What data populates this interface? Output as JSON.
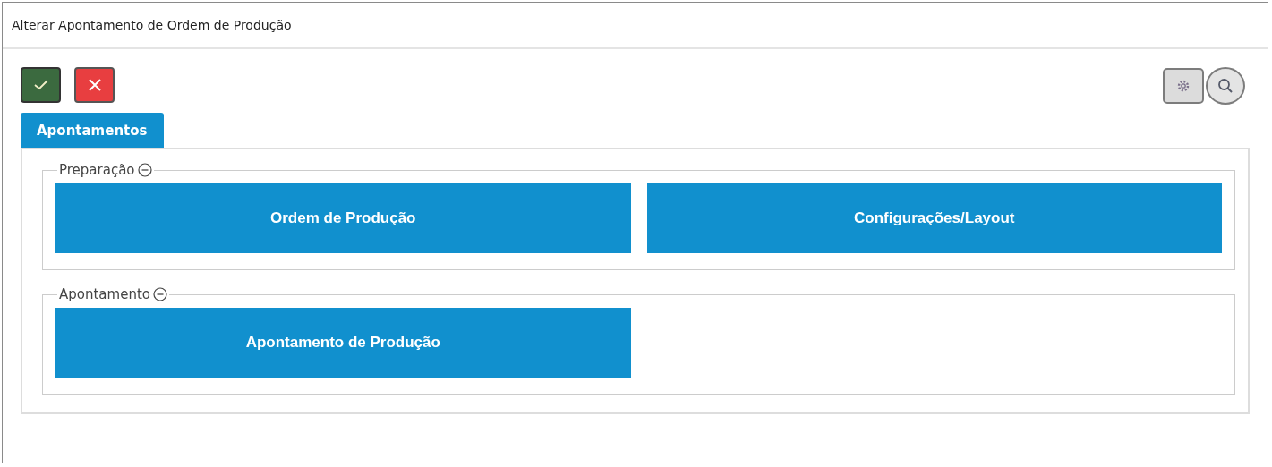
{
  "window": {
    "title": "Alterar Apontamento de Ordem de Produção"
  },
  "tabs": [
    {
      "label": "Apontamentos",
      "selected": true
    }
  ],
  "sections": [
    {
      "title": "Preparação",
      "expanded": true,
      "tiles": [
        "Ordem de Produção",
        "Configurações/Layout"
      ]
    },
    {
      "title": "Apontamento",
      "expanded": true,
      "tiles": [
        "Apontamento de Produção"
      ]
    }
  ]
}
